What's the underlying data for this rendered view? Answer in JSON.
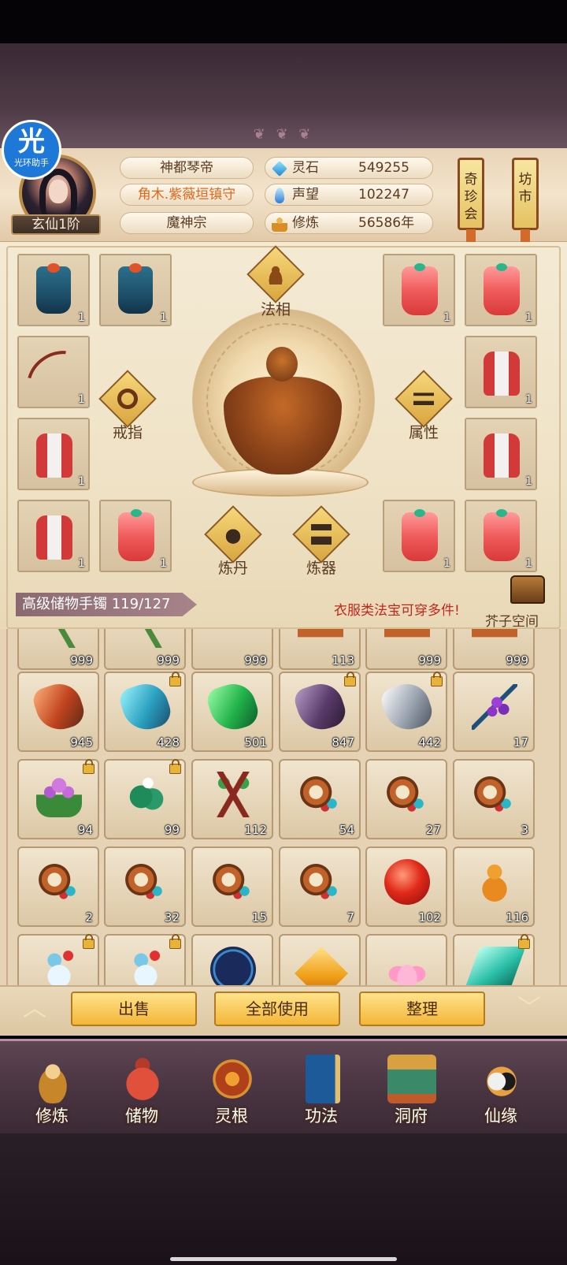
{
  "assistant_badge": {
    "icon_text": "光",
    "label": "光环助手"
  },
  "player": {
    "rank": "玄仙1阶",
    "title": "神都琴帝",
    "honor": "角木.紫薇垣镇守",
    "sect": "魔神宗"
  },
  "resources": [
    {
      "label": "灵石",
      "value": "549255",
      "icon": "spirit-stone-icon"
    },
    {
      "label": "声望",
      "value": "102247",
      "icon": "fame-icon"
    },
    {
      "label": "修炼",
      "value": "56586年",
      "icon": "cultivation-icon"
    }
  ],
  "side_tags": {
    "qizhenhui": "奇珍会",
    "fangshi": "坊市"
  },
  "equipment": {
    "labels": {
      "faxiang": "法相",
      "ring": "戒指",
      "attribute": "属性",
      "alchemy": "炼丹",
      "forge": "炼器"
    },
    "slots": [
      {
        "item": "robe-blue",
        "count": "1"
      },
      {
        "item": "robe-blue",
        "count": "1"
      },
      {
        "item": "robe-red",
        "count": "1"
      },
      {
        "item": "robe-red",
        "count": "1"
      },
      {
        "item": "bow",
        "count": "1"
      },
      {
        "item": "robe-white-red",
        "count": "1"
      },
      {
        "item": "robe-white-red",
        "count": "1"
      },
      {
        "item": "robe-white-red",
        "count": "1"
      },
      {
        "item": "robe-white-red",
        "count": "1"
      },
      {
        "item": "robe-red",
        "count": "1"
      },
      {
        "item": "robe-red",
        "count": "1"
      },
      {
        "item": "robe-red",
        "count": "1"
      }
    ]
  },
  "bag": {
    "title": "高级储物手镯 119/127",
    "tip": "衣服类法宝可穿多件!",
    "space_label": "芥子空间"
  },
  "inventory": [
    [
      "999",
      "999",
      "999",
      "113",
      "999",
      "999"
    ],
    [
      "945",
      "428",
      "501",
      "847",
      "442",
      "17"
    ],
    [
      "94",
      "99",
      "112",
      "54",
      "27",
      "3"
    ],
    [
      "2",
      "32",
      "15",
      "7",
      "102",
      "116"
    ]
  ],
  "controls": {
    "sell": "出售",
    "use_all": "全部使用",
    "sort": "整理"
  },
  "nav": [
    {
      "label": "修炼",
      "icon": "cultivate-icon"
    },
    {
      "label": "储物",
      "icon": "storage-bag-icon"
    },
    {
      "label": "灵根",
      "icon": "spirit-root-icon"
    },
    {
      "label": "功法",
      "icon": "technique-book-icon"
    },
    {
      "label": "洞府",
      "icon": "cave-abode-icon"
    },
    {
      "label": "仙缘",
      "icon": "immortal-fate-icon"
    }
  ]
}
